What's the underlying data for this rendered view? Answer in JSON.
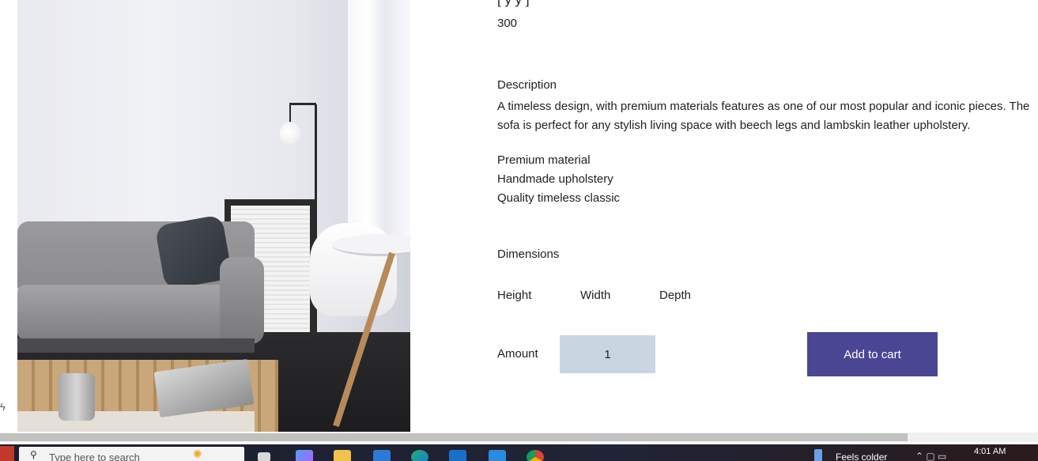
{
  "product": {
    "title_partial": "[      y      y      ]",
    "price": "300",
    "description_heading": "Description",
    "description_text": "A timeless design, with premium materials features as one of our most popular and iconic pieces. The sofa is perfect for any stylish living space with beech legs and lambskin leather upholstery.",
    "features": [
      "Premium material",
      "Handmade upholstery",
      "Quality timeless classic"
    ],
    "dimensions_heading": "Dimensions",
    "dimensions": {
      "height_label": "Height",
      "width_label": "Width",
      "depth_label": "Depth"
    },
    "amount_label": "Amount",
    "amount_value": "1",
    "add_to_cart_label": "Add to cart"
  },
  "taskbar": {
    "search_placeholder": "Type here to search",
    "weather_text": "Feels colder",
    "time": "4:01 AM"
  },
  "icons": {
    "side_icon": "lightning-icon",
    "start": "windows-start-icon",
    "search": "search-icon",
    "apps": [
      "task-view-icon",
      "copilot-icon",
      "file-explorer-icon",
      "store-icon",
      "edge-icon",
      "outlook-icon",
      "vscode-icon",
      "chrome-icon"
    ]
  },
  "colors": {
    "button_bg": "#4b4693",
    "amount_bg": "#cad5e2"
  }
}
